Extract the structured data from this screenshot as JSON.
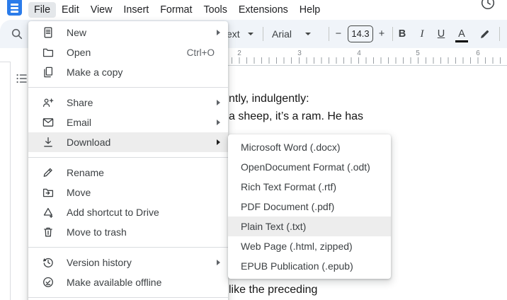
{
  "menubar": {
    "items": [
      {
        "label": "File",
        "active": true
      },
      {
        "label": "Edit"
      },
      {
        "label": "View"
      },
      {
        "label": "Insert"
      },
      {
        "label": "Format"
      },
      {
        "label": "Tools"
      },
      {
        "label": "Extensions"
      },
      {
        "label": "Help"
      }
    ]
  },
  "toolbar": {
    "style_dropdown_partial": "ext",
    "font_family": "Arial",
    "font_size": "14.3",
    "decrease_label": "−",
    "increase_label": "+",
    "bold_label": "B",
    "italic_label": "I",
    "underline_label": "U",
    "text_color_label": "A"
  },
  "ruler": {
    "numbers": [
      "2",
      "3",
      "4",
      "5",
      "6"
    ]
  },
  "file_menu": {
    "sections": [
      {
        "items": [
          {
            "label": "New",
            "has_submenu": true
          },
          {
            "label": "Open",
            "shortcut": "Ctrl+O"
          },
          {
            "label": "Make a copy"
          }
        ]
      },
      {
        "items": [
          {
            "label": "Share",
            "has_submenu": true
          },
          {
            "label": "Email",
            "has_submenu": true
          },
          {
            "label": "Download",
            "has_submenu": true,
            "highlighted": true
          }
        ]
      },
      {
        "items": [
          {
            "label": "Rename"
          },
          {
            "label": "Move"
          },
          {
            "label": "Add shortcut to Drive"
          },
          {
            "label": "Move to trash"
          }
        ]
      },
      {
        "items": [
          {
            "label": "Version history",
            "has_submenu": true
          },
          {
            "label": "Make available offline"
          }
        ]
      }
    ]
  },
  "download_submenu": {
    "items": [
      {
        "label": "Microsoft Word (.docx)"
      },
      {
        "label": "OpenDocument Format (.odt)"
      },
      {
        "label": "Rich Text Format (.rtf)"
      },
      {
        "label": "PDF Document (.pdf)"
      },
      {
        "label": "Plain Text (.txt)",
        "highlighted": true
      },
      {
        "label": "Web Page (.html, zipped)"
      },
      {
        "label": "EPUB Publication (.epub)"
      }
    ]
  },
  "document": {
    "visible_lines": [
      "ntly, indulgently:",
      "a sheep, it’s a ram. He has",
      "like the preceding"
    ]
  },
  "colors": {
    "toolbar_bg": "#f0f4f9",
    "logo_blue": "#2b7cea",
    "menu_text": "#3c4043",
    "row_highlight": "#ededed",
    "shortcut_gray": "#5f6368",
    "ruler_gray": "#80868b",
    "text_color_indicator": "#000000"
  }
}
